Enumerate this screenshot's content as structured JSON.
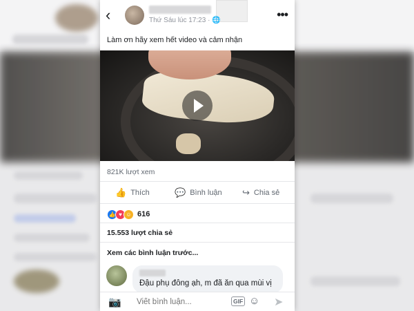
{
  "post": {
    "timestamp": "Thứ Sáu lúc 17:23 ·",
    "privacy_icon": "globe-icon",
    "caption": "Làm ơn hãy xem hết video và cảm nhận",
    "views": "821K lượt xem",
    "reactions_count": "616",
    "shares": "15.553 lượt chia sẻ",
    "previous_comments": "Xem các bình luận trước..."
  },
  "actions": {
    "like": "Thích",
    "comment": "Bình luận",
    "share": "Chia sẻ"
  },
  "comment": {
    "text": "Đậu phụ đông ạh, m đã ăn qua mùi vị"
  },
  "composer": {
    "placeholder": "Viết bình luận...",
    "gif_label": "GIF"
  },
  "colors": {
    "like_blue": "#1877f2",
    "love_red": "#f33e58",
    "haha_yellow": "#f7b125"
  }
}
